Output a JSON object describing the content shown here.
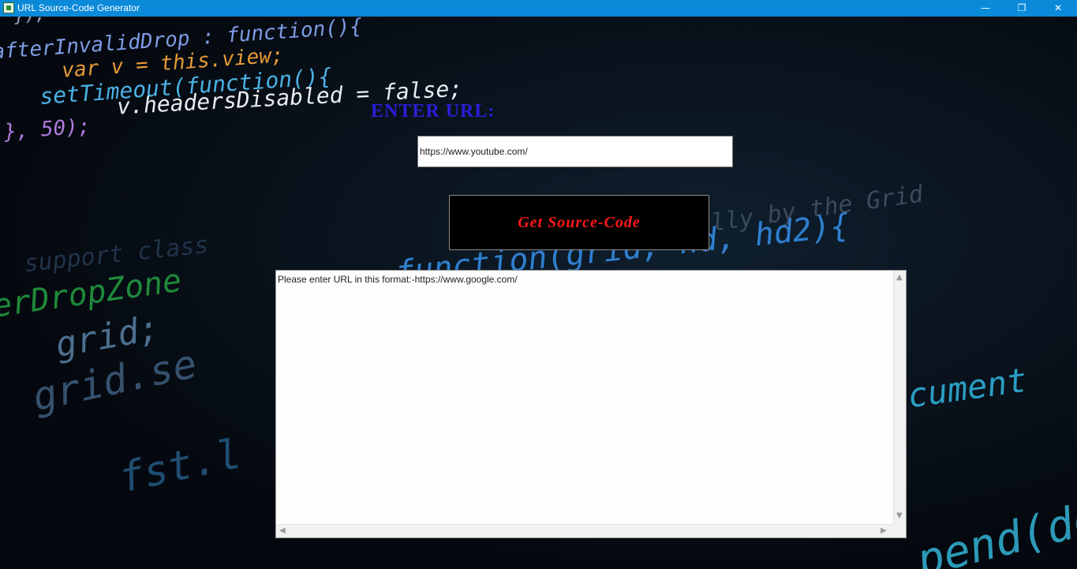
{
  "window": {
    "title": "URL Source-Code Generator",
    "controls": {
      "minimize": "—",
      "maximize": "❐",
      "close": "✕"
    }
  },
  "form": {
    "label": "ENTER URL:",
    "url_value": "https://www.youtube.com/",
    "button_label": "Get Source-Code"
  },
  "output": {
    "text": "Please enter URL in this format:-https://www.google.com/",
    "scroll_up": "▲",
    "scroll_down": "▼",
    "scroll_left": "◀",
    "scroll_right": "▶"
  },
  "background_code": [
    {
      "text": "});"
    },
    {
      "text": "afterInvalidDrop : function(){"
    },
    {
      "text": "var v = this.view;"
    },
    {
      "text": "setTimeout(function(){"
    },
    {
      "text": "v.headersDisabled = false;"
    },
    {
      "text": "}, 50);"
    },
    {
      "text": "lly by the Grid"
    },
    {
      "text": "function(grid, hd, hd2){"
    },
    {
      "text": "support class"
    },
    {
      "text": "erDropZone"
    },
    {
      "text": "grid;"
    },
    {
      "text": "grid.se"
    },
    {
      "text": "cument"
    },
    {
      "text": "fst.l"
    },
    {
      "text": "pend(do"
    }
  ],
  "colors": {
    "titlebar": "#0a8ad9",
    "label": "#2b1ed8",
    "button_text": "#ff1818",
    "button_bg": "#000000",
    "page_bg": "#04070d"
  }
}
